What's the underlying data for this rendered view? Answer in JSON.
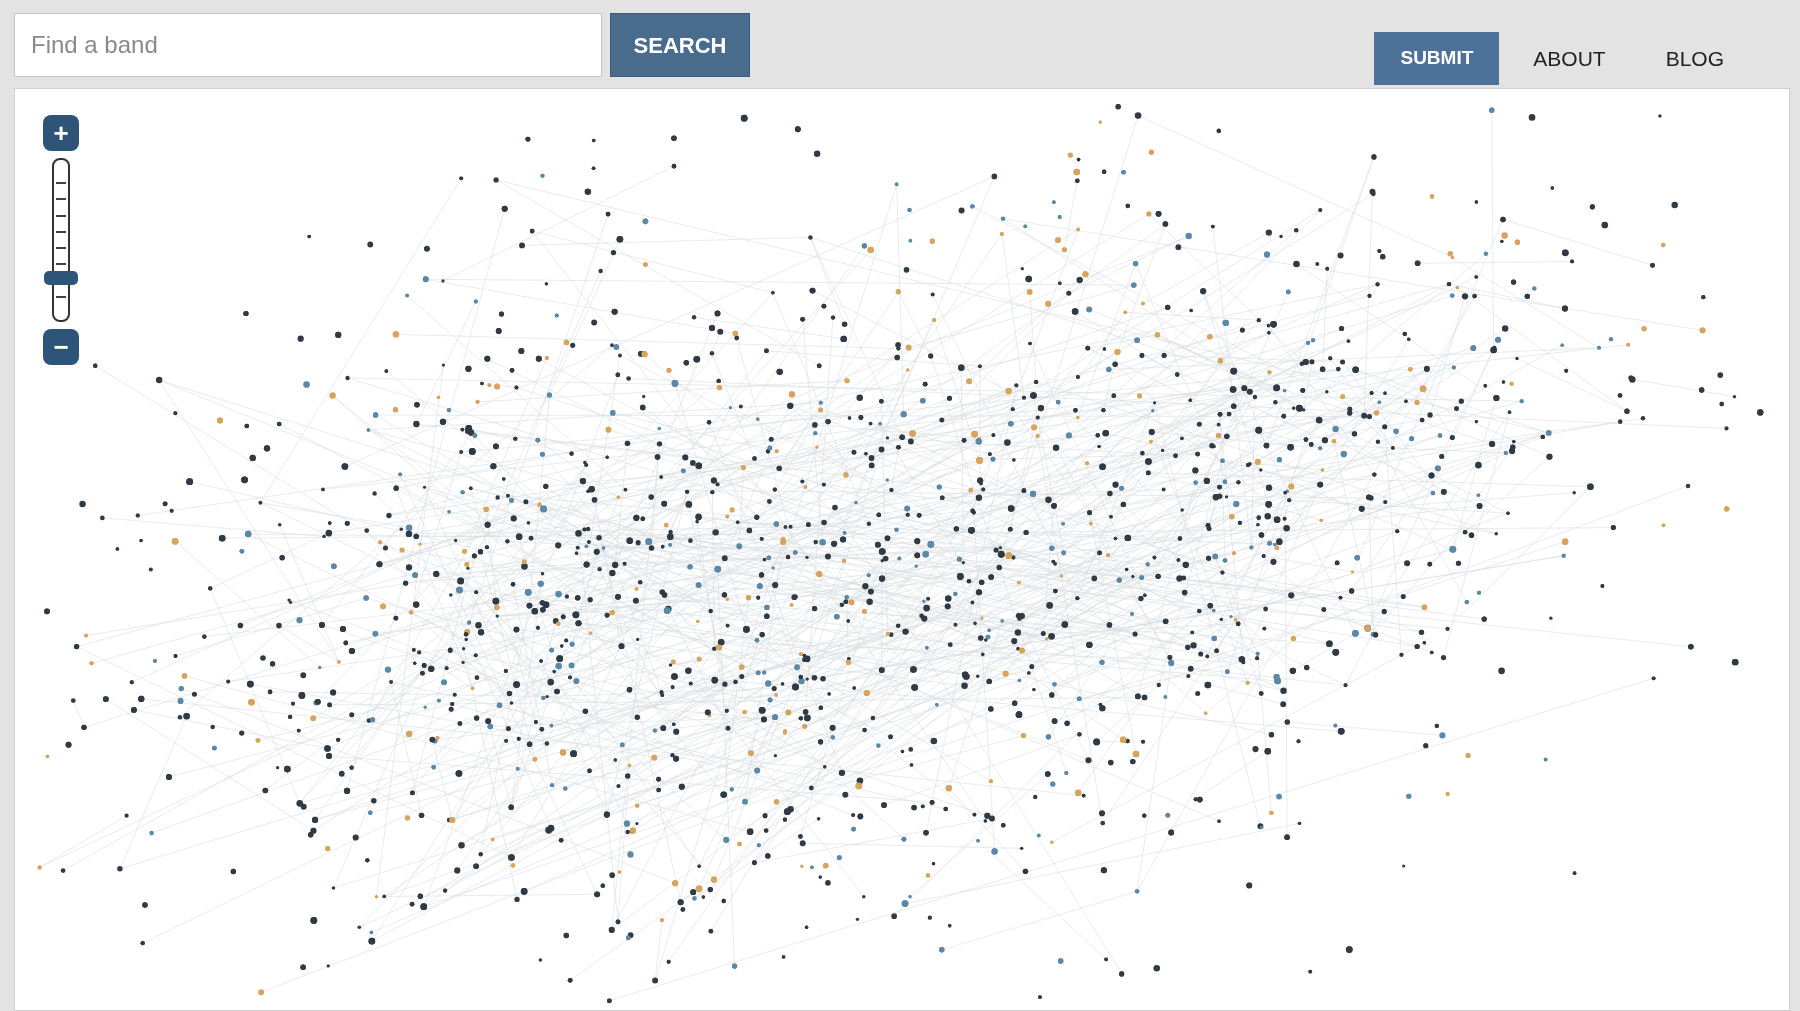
{
  "search": {
    "placeholder": "Find a band",
    "button": "SEARCH"
  },
  "nav": [
    {
      "label": "SUBMIT",
      "selected": true
    },
    {
      "label": "ABOUT",
      "selected": false
    },
    {
      "label": "BLOG",
      "selected": false
    }
  ],
  "zoom": {
    "plus": "+",
    "minus": "−",
    "level": 0.25
  }
}
